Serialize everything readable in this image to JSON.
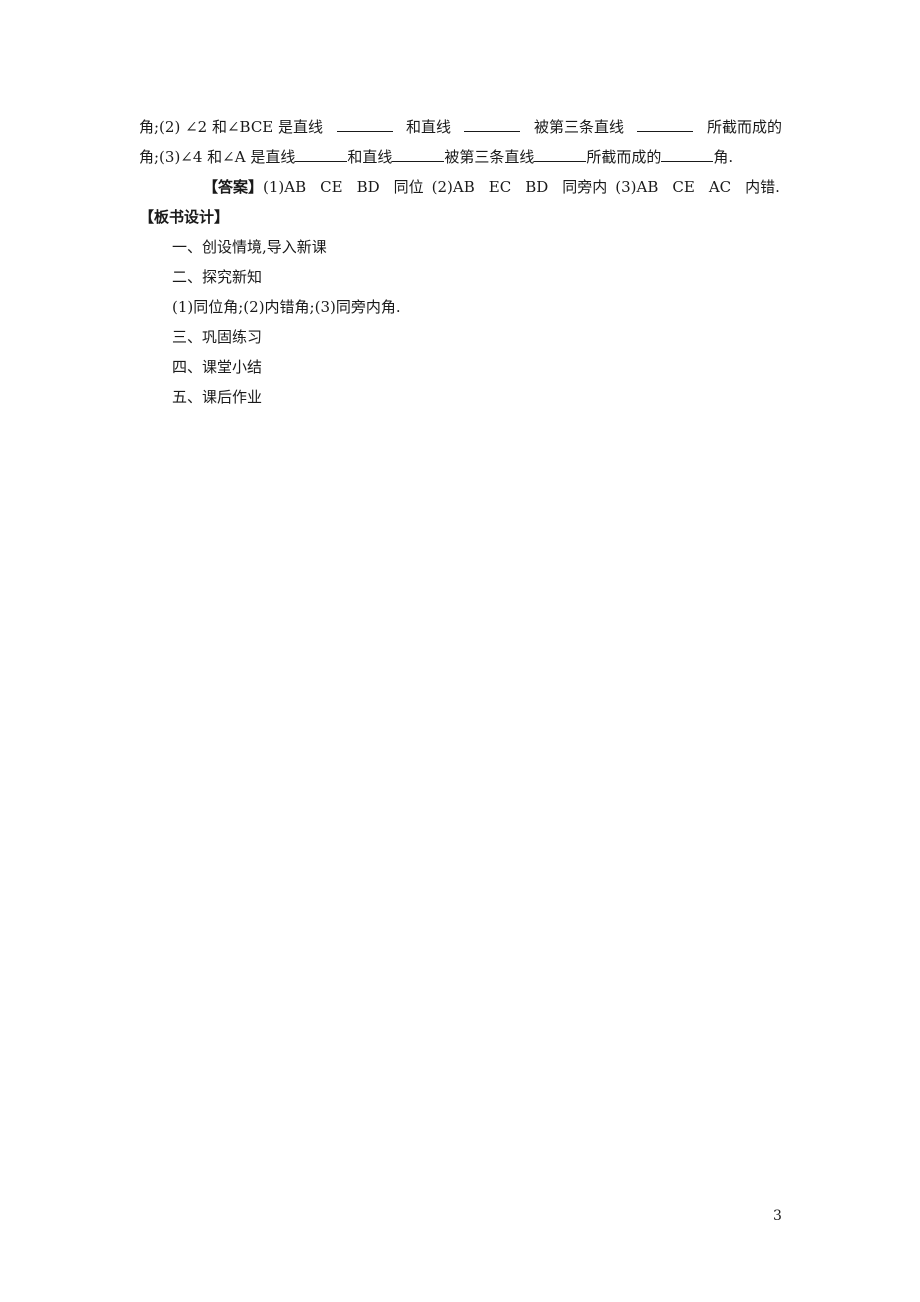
{
  "document": {
    "question_continuation": {
      "line1": {
        "part1": "角;(2) ∠2 和∠BCE 是直线",
        "part2": "和直线",
        "part3": "被第三条直线",
        "part4": "所截而成的"
      },
      "line2": {
        "part1": "角;(3)∠4 和∠A 是直线",
        "part2": "和直线",
        "part3": "被第三条直线",
        "part4": "所截而成的",
        "part5": "角."
      }
    },
    "answer": {
      "label": "【答案】",
      "items": [
        "(1)AB",
        "CE",
        "BD",
        "同位",
        "(2)AB",
        "EC",
        "BD",
        "同旁内",
        "(3)AB",
        "CE",
        "AC",
        "内错."
      ]
    },
    "board_design": {
      "title": "【板书设计】",
      "items": [
        "一、创设情境,导入新课",
        "二、探究新知",
        "(1)同位角;(2)内错角;(3)同旁内角.",
        "三、巩固练习",
        "四、课堂小结",
        "五、课后作业"
      ]
    },
    "page_number": "3"
  }
}
